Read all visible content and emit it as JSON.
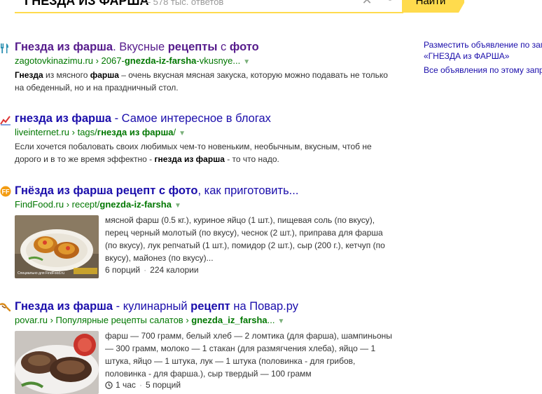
{
  "search": {
    "query": "ГНЕЗДА ИЗ ФАРША",
    "count": "— 578 тыс. ответов",
    "find_label": "Найти"
  },
  "results": [
    {
      "favicon": "fork-knife-icon",
      "title_parts": [
        "Гнезда из фарша",
        ". Вкусные ",
        "рецепты",
        " с ",
        "фото"
      ],
      "url_parts": [
        "zagotovkinazimu.ru › 2067-",
        "gnezda-iz-farsha",
        "-vkusnye..."
      ],
      "snippet_parts": [
        "Гнезда",
        " из мясного ",
        "фарша",
        " – очень вкусная мясная закуска, которую можно подавать не только на обеденный, но и на праздничный стол."
      ]
    },
    {
      "favicon": "chart-line-icon",
      "title_parts": [
        "гнезда из фарша",
        " - Самое интересное в блогах"
      ],
      "url_parts": [
        "liveinternet.ru › tags/",
        "гнезда из фарша",
        "/"
      ],
      "snippet_parts": [
        "Если хочется побаловать своих любимых чем-то новеньким, необычным, вкусным, чтоб не дорого и в то же время эффектно - ",
        "гнезда из фарша",
        " - то что надо."
      ]
    },
    {
      "favicon": "findfood-icon",
      "title_parts": [
        "Гнёзда из фарша рецепт с фото",
        ", как приготовить..."
      ],
      "url_parts": [
        "FindFood.ru › recept/",
        "gnezda-iz-farsha",
        ""
      ],
      "snippet": "мясной фарш (0.5 кг.), куриное яйцо (1 шт.), пищевая соль (по вкусу), перец черный молотый (по вкусу), чеснок (2 шт.), приправа для фарша (по вкусу), лук репчатый (1 шт.), помидор (2 шт.), сыр (200 г.), кетчуп (по вкусу), майонез (по вкусу)...",
      "meta": [
        "6 порций",
        "224 калории"
      ],
      "thumb_caption": "Специально для FindFood.ru"
    },
    {
      "favicon": "povar-icon",
      "title_parts": [
        "Гнезда из фарша",
        " - кулинарный ",
        "рецепт",
        " на Повар.ру"
      ],
      "url_parts": [
        "povar.ru › Популярные рецепты салатов › ",
        "gnezda_iz_farsha",
        "..."
      ],
      "snippet": "фарш — 700 грамм, белый хлеб — 2 ломтика (для фарша), шампиньоны — 300 грамм, молоко — 1 стакан (для размягчения хлеба), яйцо — 1 штука, яйцо — 1 штука, лук — 1 штука (половинка - для грибов, половинка - для фарша.), сыр твердый — 100 грамм",
      "meta": [
        "1 час",
        "5 порций"
      ]
    }
  ],
  "side": {
    "ad_link_line1": "Разместить объявление по запросу",
    "ad_link_line2": "«ГНЕЗДА из ФАРША»",
    "all_ads": "Все объявления по этому запросу"
  },
  "colors": {
    "title_link": "#1a0dab",
    "visited_link": "#551a8b",
    "url_green": "#007700",
    "accent_yellow": "#ffdb4d"
  }
}
